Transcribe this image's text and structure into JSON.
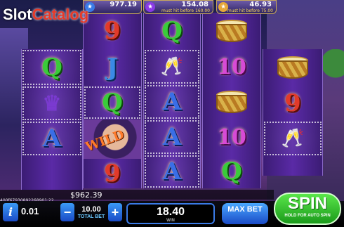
{
  "logo": {
    "part1": "Slot",
    "part2": "Catalog"
  },
  "jackpots": [
    {
      "value": "977.19",
      "note": "",
      "star_color": "#3a7ae6"
    },
    {
      "value": "154.08",
      "note": "must hit before 160.00",
      "star_color": "#8a3ae6"
    },
    {
      "value": "46.93",
      "note": "must hit before 75.00",
      "star_color": "#e6a83a"
    }
  ],
  "reels": [
    {
      "symbols": [
        "Q",
        "jester",
        "A"
      ]
    },
    {
      "symbols": [
        "9",
        "J",
        "Q",
        "wild",
        "9"
      ]
    },
    {
      "symbols": [
        "Q",
        "glasses",
        "A",
        "A",
        "A"
      ]
    },
    {
      "symbols": [
        "drum",
        "10",
        "drum",
        "10",
        "Q"
      ]
    },
    {
      "symbols": [
        "drum",
        "9",
        "glasses"
      ]
    }
  ],
  "wild_label": "WILD",
  "balance": "$962.39",
  "session_id": "400f67930892268901:22",
  "controls": {
    "info": "i",
    "coin": "0.01",
    "minus": "−",
    "plus": "+",
    "total_bet": "10.00",
    "total_bet_label": "TOTAL BET",
    "win": "18.40",
    "win_label": "WIN",
    "max_bet": "MAX BET",
    "spin": "SPIN",
    "spin_sub": "HOLD FOR AUTO SPIN"
  }
}
